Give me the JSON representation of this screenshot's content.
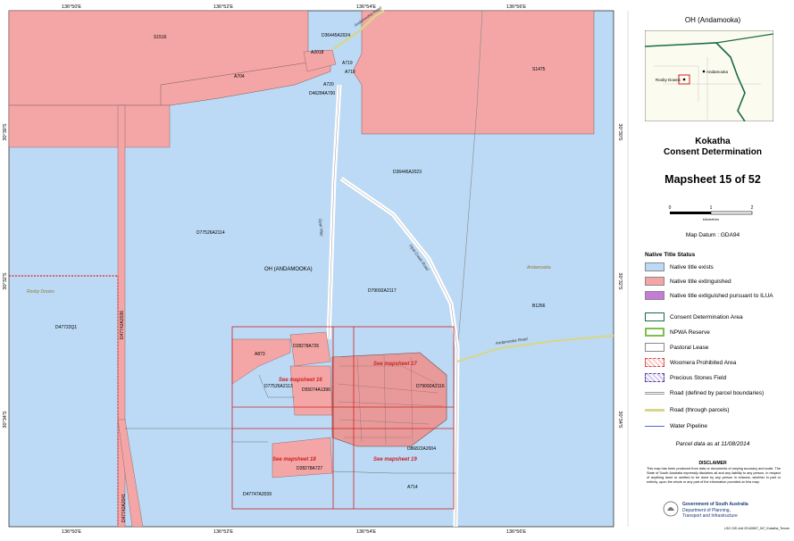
{
  "coords": {
    "top": [
      "136°50'E",
      "136°52'E",
      "136°54'E",
      "136°56'E"
    ],
    "bottom": [
      "136°50'E",
      "136°52'E",
      "136°54'E",
      "136°56'E"
    ],
    "left": [
      "30°30'S",
      "30°32'S",
      "30°34'S"
    ],
    "right": [
      "30°30'S",
      "30°32'S",
      "30°34'S"
    ]
  },
  "parcels": {
    "s1516": "S1516",
    "a704": "A704",
    "d36445a2024": "D36445A2024",
    "a2018": "A2018",
    "a719a": "A719",
    "a719b": "A719",
    "a720": "A720",
    "d46284a700": "D46284A700",
    "s1475": "S1475",
    "d36445a2023": "D36445A2023",
    "d77526a2114": "D77526A2114",
    "oh_andamooka": "OH (ANDAMOOKA)",
    "d79092a2117": "D79092A2117",
    "b1266": "B1266",
    "roxby_downs": "Roxby Downs",
    "andamooka": "Andamooka",
    "d47722q1": "D47722Q1",
    "d47742a2036": "D47742A2036",
    "a873": "A873",
    "d28278a726": "D28278A726",
    "d77526a2113": "D77526A2113",
    "d55074a1396": "D55074A1396",
    "d79092a2116": "D79092A2116",
    "d86822a2004": "D86822A2004",
    "d28278a727": "D28278A727",
    "a714": "A714",
    "d47747a2039": "D47747A2039",
    "d47742a2041": "D47742A2041"
  },
  "roads": {
    "north": "Andamooka Road",
    "opal_way": "Opal Way",
    "east": "Andamooka Road",
    "diag": "Opal Creek Road"
  },
  "insets": {
    "m17": "See mapsheet 17",
    "m16": "See mapsheet 16",
    "m18": "See mapsheet 18",
    "m19": "See mapsheet 19"
  },
  "panel": {
    "inset_title": "OH (Andamooka)",
    "inset_labels": {
      "andamooka": "Andamooka",
      "roxby": "Roxby Downs"
    },
    "determination_name": "Kokatha",
    "determination_type": "Consent Determination",
    "mapsheet": "Mapsheet 15 of 52",
    "scale_ticks": [
      "0",
      "1",
      "2"
    ],
    "scale_unit": "kilometres",
    "datum": "Map Datum : GDA94",
    "legend_heading": "Native Title Status",
    "legend": [
      {
        "label": "Native title exists",
        "color": "#bcdaf5"
      },
      {
        "label": "Native title extinguished",
        "color": "#f4a6a6"
      },
      {
        "label": "Native title extiguished pursuant to ILUA",
        "color": "#c47cd6"
      },
      {
        "label": "Consent Determination Area"
      },
      {
        "label": "NPWA Reserve"
      },
      {
        "label": "Pastoral Lease"
      },
      {
        "label": "Woomera Prohibited Area"
      },
      {
        "label": "Precious Stones Field"
      },
      {
        "label": "Road (defined by parcel boundaries)"
      },
      {
        "label": "Road (through parcels)"
      },
      {
        "label": "Water Pipeline"
      }
    ],
    "parcel_date": "Parcel data as at 11/08/2014",
    "disclaimer_title": "DISCLAIMER",
    "disclaimer_text": "This map has been produced from data or documents of varying accuracy and scale. The State of South Australia expressly disclaims all and any liability to any person, in respect of anything done or omitted to be done by any person in reliance, whether in part or entirely, upon the whole or any part of the information provided on this map.",
    "gov_line1": "Government of South Australia",
    "gov_line2": "Department of Planning,",
    "gov_line3": "Transport and Infrastructure",
    "file_ref": "LSG GIS Unit 20140807_047_Kokatha_Tenure"
  },
  "colors": {
    "native_exists": "#bcdaf5",
    "extinguished": "#f4a6a6",
    "ilua": "#c47cd6",
    "woomera": "#d94040"
  }
}
